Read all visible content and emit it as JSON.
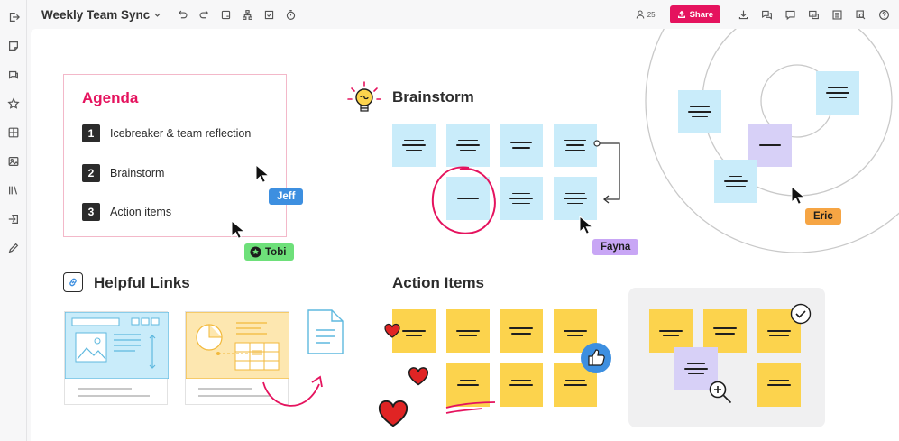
{
  "board": {
    "title": "Weekly Team Sync"
  },
  "header": {
    "collaborator_count": "25",
    "share_label": "Share"
  },
  "agenda": {
    "title": "Agenda",
    "items": [
      {
        "number": "1",
        "label": "Icebreaker & team reflection"
      },
      {
        "number": "2",
        "label": "Brainstorm"
      },
      {
        "number": "3",
        "label": "Action items"
      }
    ]
  },
  "sections": {
    "brainstorm": "Brainstorm",
    "helpful_links": "Helpful Links",
    "action_items": "Action Items"
  },
  "cursors": {
    "jeff": "Jeff",
    "tobi": "Tobi",
    "fayna": "Fayna",
    "eric": "Eric"
  },
  "colors": {
    "accent": "#e5135e",
    "sticky_blue": "#c9ecfa",
    "sticky_purple": "#d7d0f7",
    "sticky_yellow": "#fcd34d",
    "label_jeff": "#3d8fe0",
    "label_tobi": "#6ee07a",
    "label_fayna": "#c8a6f5",
    "label_eric": "#f6a544"
  },
  "icons": {
    "sidebar": [
      "exit-icon",
      "sticky-note-icon",
      "comment-icon",
      "star-icon",
      "frame-icon",
      "image-icon",
      "library-icon",
      "import-icon",
      "pen-icon"
    ],
    "toolbar": [
      "undo-icon",
      "redo-icon",
      "sticky-icon",
      "org-chart-icon",
      "select-icon",
      "timer-icon"
    ],
    "right": [
      "download-icon",
      "chat-icon",
      "comment-icon",
      "presentation-icon",
      "list-icon",
      "search-icon",
      "help-icon"
    ]
  }
}
